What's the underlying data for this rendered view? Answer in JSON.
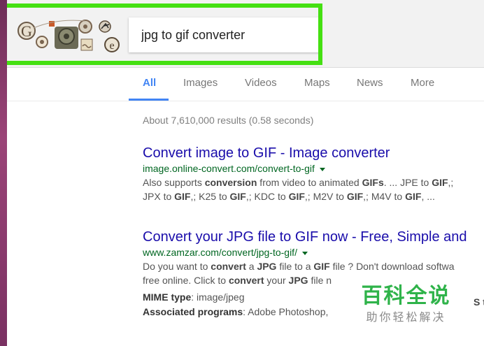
{
  "search": {
    "query": "jpg to gif converter"
  },
  "tabs": [
    {
      "label": "All",
      "active": true
    },
    {
      "label": "Images"
    },
    {
      "label": "Videos"
    },
    {
      "label": "Maps"
    },
    {
      "label": "News"
    },
    {
      "label": "More"
    }
  ],
  "stats": "About 7,610,000 results (0.58 seconds)",
  "results": [
    {
      "title": "Convert image to GIF - Image converter",
      "url": "image.online-convert.com/convert-to-gif",
      "snippet_line1_a": "Also supports ",
      "snippet_line1_b": "conversion",
      "snippet_line1_c": " from video to animated ",
      "snippet_line1_d": "GIFs",
      "snippet_line1_e": ". ... JPE to ",
      "snippet_line1_f": "GIF",
      "snippet_line1_g": ",; ",
      "snippet_line2_a": "JPX to ",
      "snippet_line2_b": "GIF",
      "snippet_line2_c": ",; K25 to ",
      "snippet_line2_d": "GIF",
      "snippet_line2_e": ",; KDC to ",
      "snippet_line2_f": "GIF",
      "snippet_line2_g": ",; M2V to ",
      "snippet_line2_h": "GIF",
      "snippet_line2_i": ",; M4V to ",
      "snippet_line2_j": "GIF",
      "snippet_line2_k": ", ..."
    },
    {
      "title": "Convert your JPG file to GIF now - Free, Simple and",
      "url": "www.zamzar.com/convert/jpg-to-gif/",
      "snippet_line1_a": "Do you want to ",
      "snippet_line1_b": "convert",
      "snippet_line1_c": " a ",
      "snippet_line1_d": "JPG",
      "snippet_line1_e": " file to a ",
      "snippet_line1_f": "GIF",
      "snippet_line1_g": " file ? Don't download softwa",
      "snippet_line2_a": "free online. Click to ",
      "snippet_line2_b": "convert",
      "snippet_line2_c": " your ",
      "snippet_line2_d": "JPG",
      "snippet_line2_e": " file n",
      "mime_label": "MIME type",
      "mime_value": ": image/jpeg",
      "assoc_label": "Associated programs",
      "assoc_value": ": Adobe Photoshop,",
      "overflow_text": "S to"
    }
  ],
  "watermark": {
    "main": "百科全说",
    "sub": "助你轻松解决"
  },
  "colors": {
    "highlight": "#45e012",
    "link": "#1a0dab",
    "url": "#006621",
    "active_tab": "#4285f4"
  }
}
